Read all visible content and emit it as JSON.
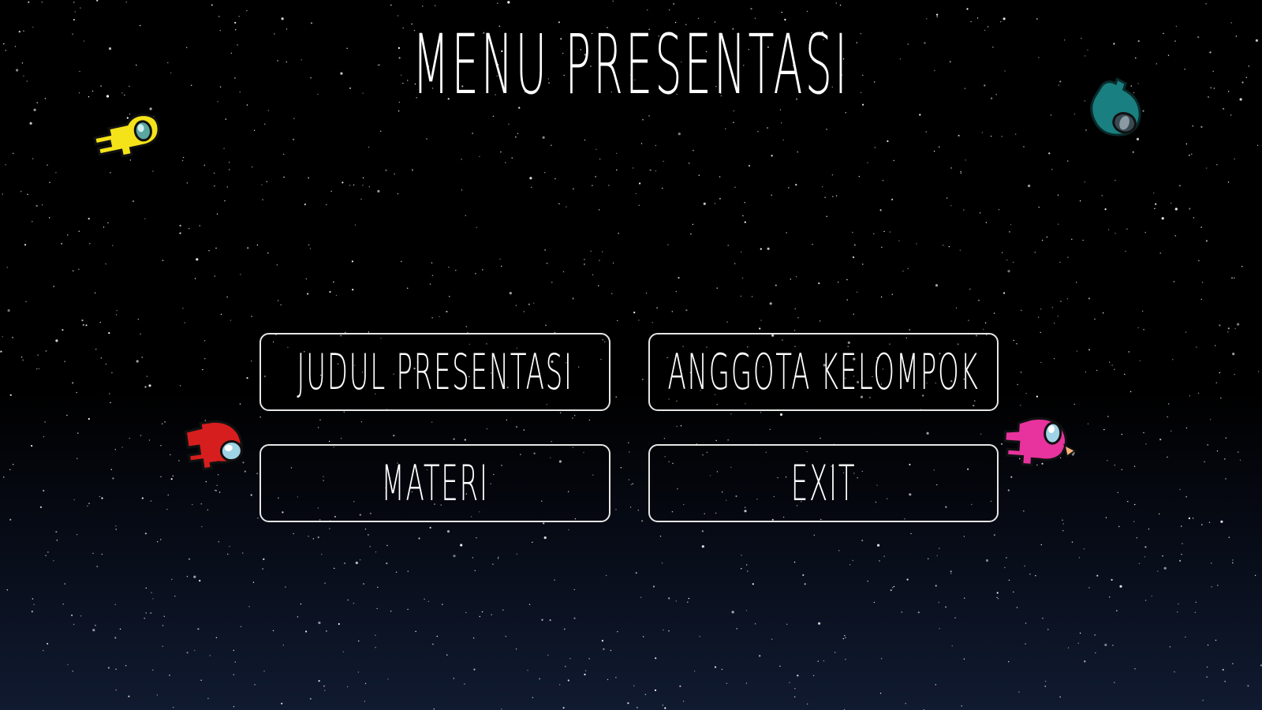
{
  "title": "MENU PRESENTASI",
  "buttons": {
    "judul": "JUDUL PRESENTASI",
    "anggota": "ANGGOTA KELOMPOK",
    "materi": "MATERI",
    "exit": "EXIT"
  },
  "colors": {
    "background": "#000000",
    "text": "#ffffff",
    "button_border": "#e6e6e6",
    "crew_yellow": "#f5e31a",
    "crew_teal": "#1a7f80",
    "crew_red": "#d71e1e",
    "crew_pink": "#e8329d",
    "visor": "#9fd3e6"
  },
  "decorations": [
    "yellow-crewmate-icon",
    "teal-crewmate-icon",
    "red-crewmate-icon",
    "pink-crewmate-icon",
    "starfield"
  ]
}
